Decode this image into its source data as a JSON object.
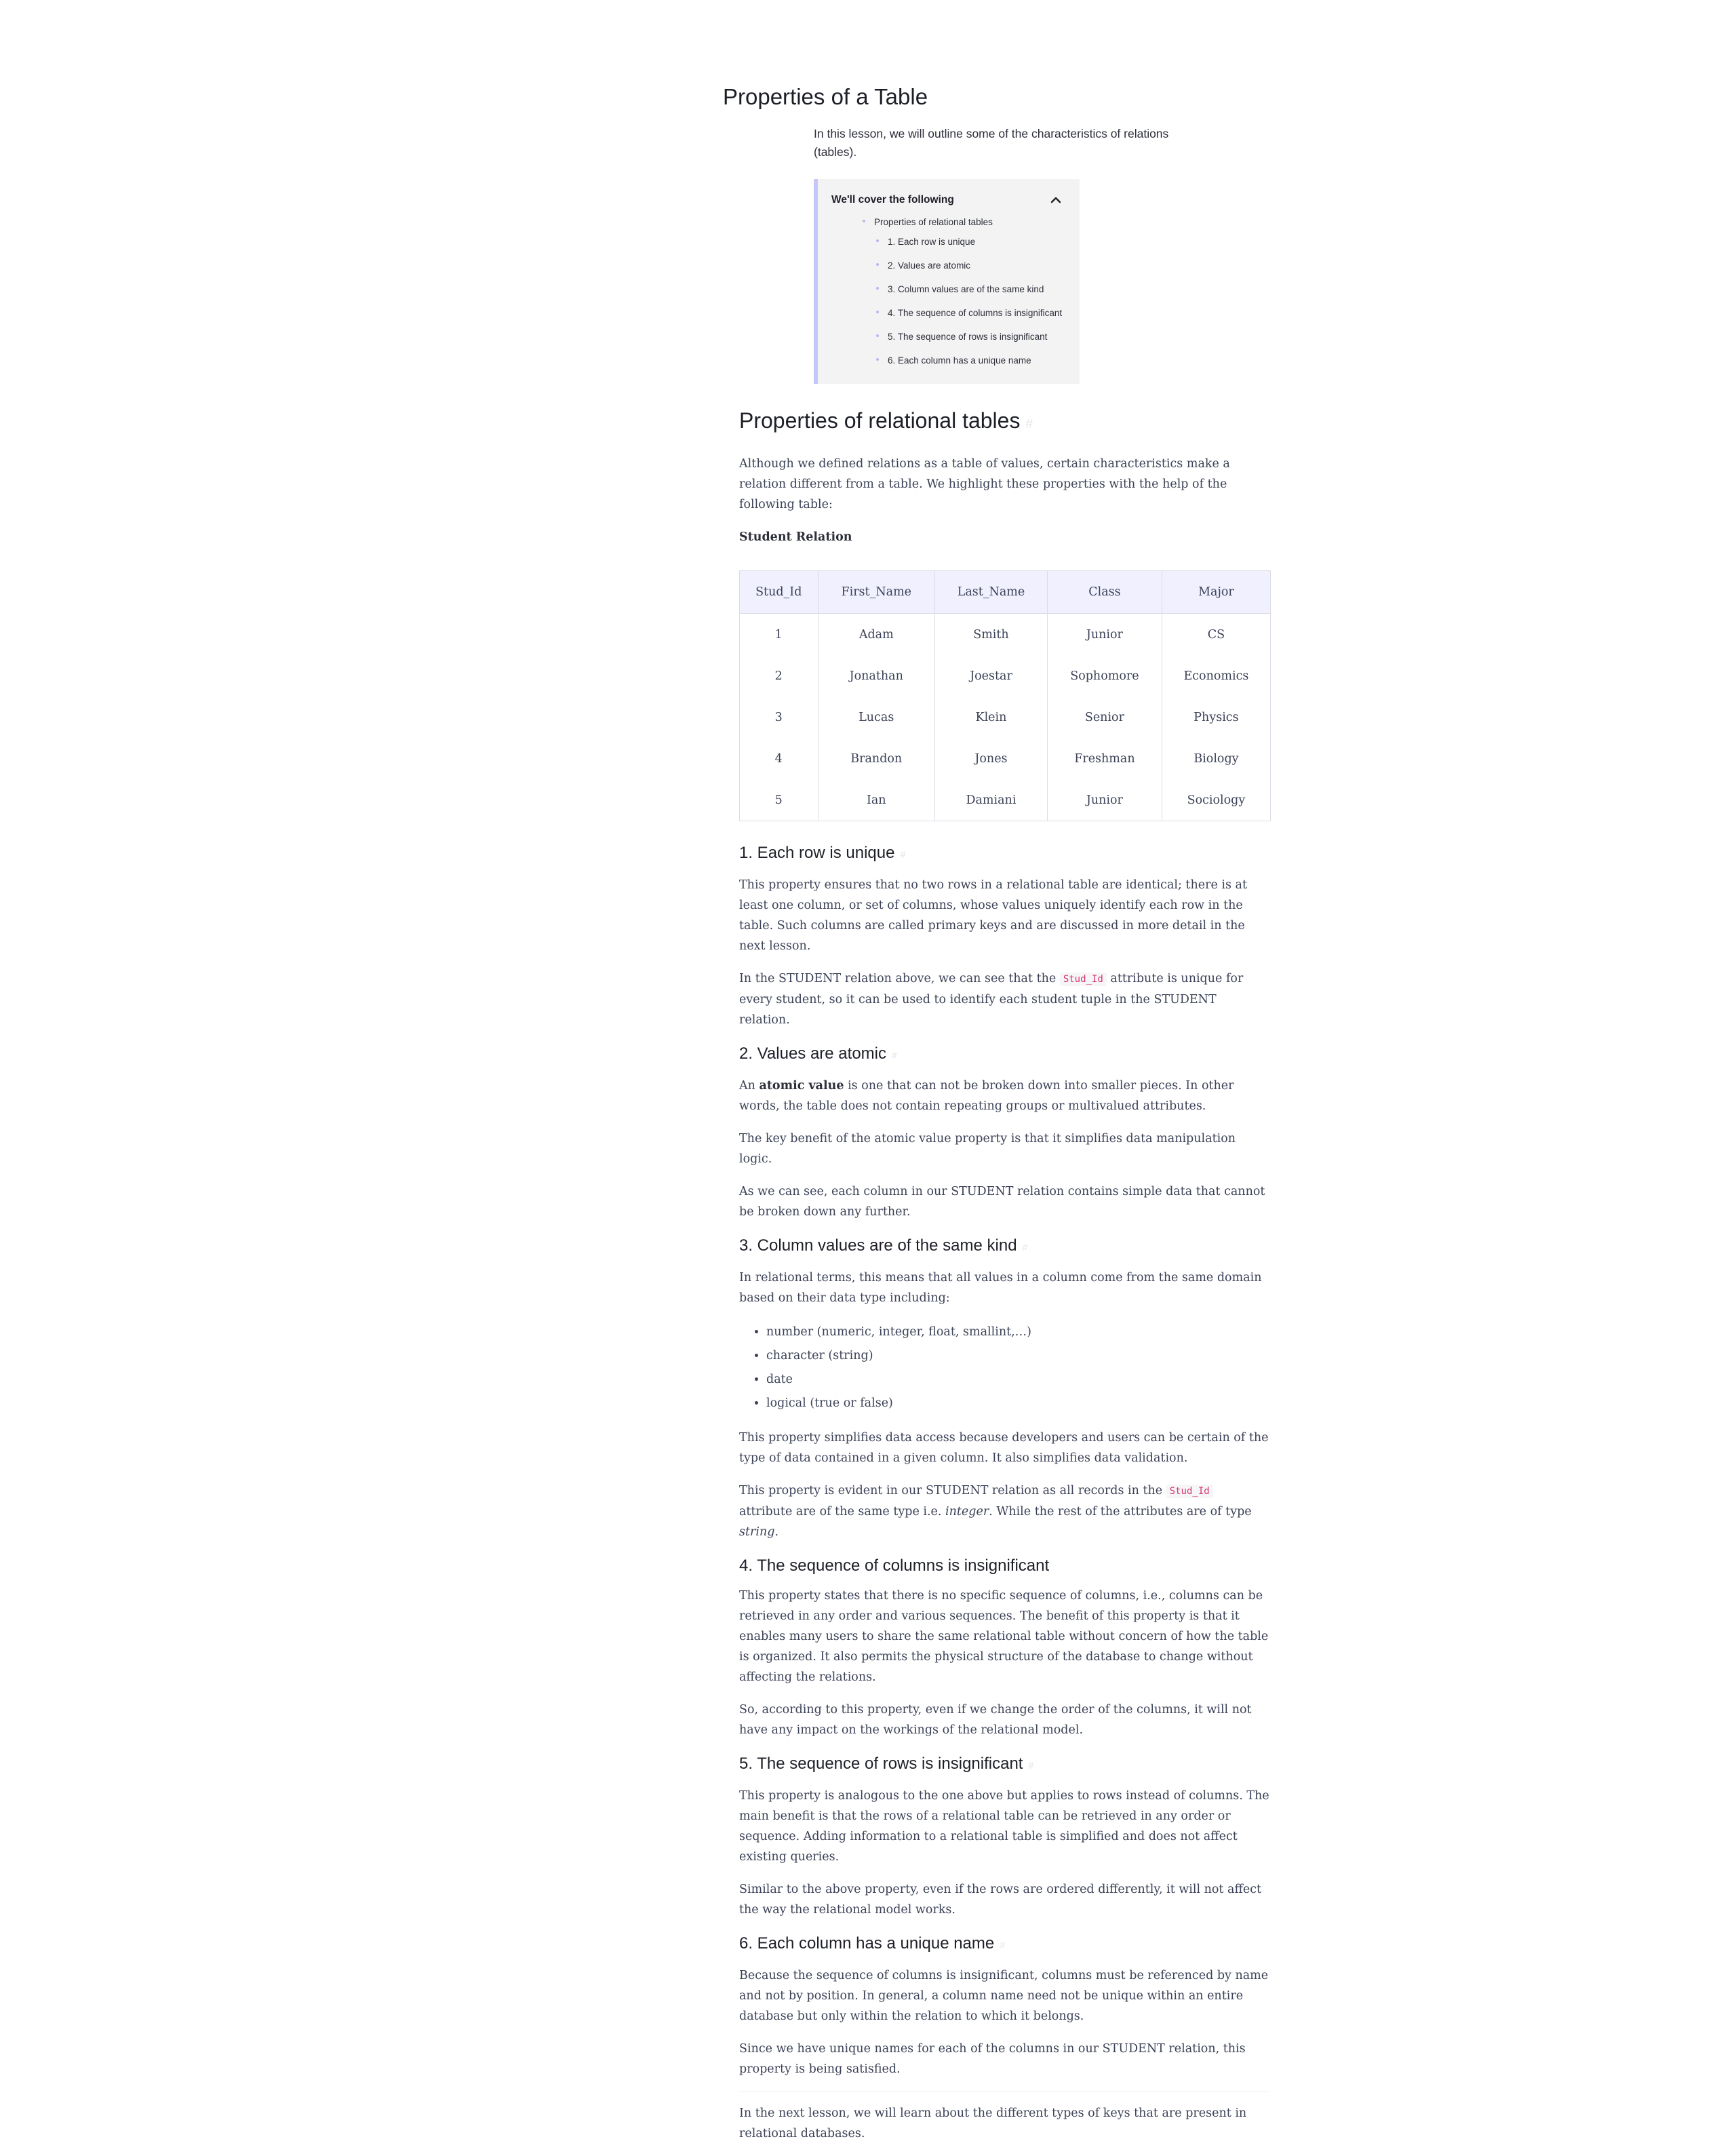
{
  "lesson": {
    "title": "Properties of a Table",
    "intro": "In this lesson, we will outline some of the characteristics of relations (tables)."
  },
  "toc": {
    "title": "We'll cover the following",
    "toggle_icon": "chevron-up-icon",
    "section": "Properties of relational tables",
    "items": [
      "1. Each row is unique",
      "2. Values are atomic",
      "3. Column values are of the same kind",
      "4. The sequence of columns is insignificant",
      "5. The sequence of rows is insignificant",
      "6. Each column has a unique name"
    ]
  },
  "main": {
    "heading": "Properties of relational tables",
    "intro": "Although we defined relations as a table of values, certain characteristics make a relation different from a table. We highlight these properties with the help of the following table:",
    "table_caption": "Student Relation",
    "table": {
      "headers": [
        "Stud_Id",
        "First_Name",
        "Last_Name",
        "Class",
        "Major"
      ],
      "rows": [
        [
          "1",
          "Adam",
          "Smith",
          "Junior",
          "CS"
        ],
        [
          "2",
          "Jonathan",
          "Joestar",
          "Sophomore",
          "Economics"
        ],
        [
          "3",
          "Lucas",
          "Klein",
          "Senior",
          "Physics"
        ],
        [
          "4",
          "Brandon",
          "Jones",
          "Freshman",
          "Biology"
        ],
        [
          "5",
          "Ian",
          "Damiani",
          "Junior",
          "Sociology"
        ]
      ]
    }
  },
  "s1": {
    "heading": "1. Each row is unique",
    "p1": "This property ensures that no two rows in a relational table are identical; there is at least one column, or set of columns, whose values uniquely identify each row in the table. Such columns are called primary keys and are discussed in more detail in the next lesson.",
    "p2_a": "In the STUDENT relation above, we can see that the ",
    "p2_code": "Stud_Id",
    "p2_b": " attribute is unique for every student, so it can be used to identify each student tuple in the STUDENT relation."
  },
  "s2": {
    "heading": "2. Values are atomic",
    "p1_a": "An ",
    "p1_bold": "atomic value",
    "p1_b": " is one that can not be broken down into smaller pieces. In other words, the table does not contain repeating groups or multivalued attributes.",
    "p2": "The key benefit of the atomic value property is that it simplifies data manipulation logic.",
    "p3": "As we can see, each column in our STUDENT relation contains simple data that cannot be broken down any further."
  },
  "s3": {
    "heading": "3. Column values are of the same kind",
    "p1": "In relational terms, this means that all values in a column come from the same domain based on their data type including:",
    "bullets": [
      "number (numeric, integer, float, smallint,…)",
      "character (string)",
      "date",
      "logical (true or false)"
    ],
    "p2": "This property simplifies data access because developers and users can be certain of the type of data contained in a given column. It also simplifies data validation.",
    "p3_a": "This property is evident in our STUDENT relation as all records in the ",
    "p3_code": "Stud_Id",
    "p3_b": " attribute are of the same type i.e. ",
    "p3_math1": "integer",
    "p3_c": ". While the rest of the attributes are of type ",
    "p3_math2": "string",
    "p3_d": "."
  },
  "s4": {
    "heading": "4. The sequence of columns is insignificant",
    "p1": "This property states that there is no specific sequence of columns, i.e., columns can be retrieved in any order and various sequences. The benefit of this property is that it enables many users to share the same relational table without concern of how the table is organized. It also permits the physical structure of the database to change without affecting the relations.",
    "p2": "So, according to this property, even if we change the order of the columns, it will not have any impact on the workings of the relational model."
  },
  "s5": {
    "heading": "5. The sequence of rows is insignificant",
    "p1": "This property is analogous to the one above but applies to rows instead of columns. The main benefit is that the rows of a relational table can be retrieved in any order or sequence. Adding information to a relational table is simplified and does not affect existing queries.",
    "p2": "Similar to the above property, even if the rows are ordered differently, it will not affect the way the relational model works."
  },
  "s6": {
    "heading": "6. Each column has a unique name",
    "p1": "Because the sequence of columns is insignificant, columns must be referenced by name and not by position. In general, a column name need not be unique within an entire database but only within the relation to which it belongs.",
    "p2": "Since we have unique names for each of the columns in our STUDENT relation, this property is being satisfied."
  },
  "outro": "In the next lesson, we will learn about the different types of keys that are present in relational databases.",
  "anchor_icon": "link-icon"
}
